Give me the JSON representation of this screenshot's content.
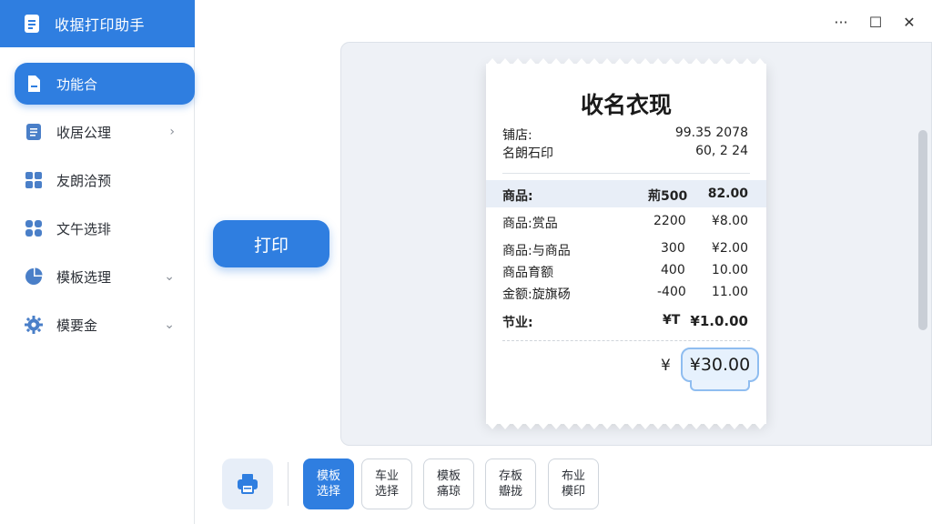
{
  "app": {
    "title": "收据打印助手"
  },
  "sidebar": {
    "items": [
      {
        "label": "功能合",
        "icon": "document-icon",
        "active": true
      },
      {
        "label": "收居公理",
        "icon": "list-icon",
        "caret": "›"
      },
      {
        "label": "友朗洽预",
        "icon": "grid-icon"
      },
      {
        "label": "文午选琲",
        "icon": "apps-icon"
      },
      {
        "label": "模板选理",
        "icon": "pie-chart-icon",
        "caret": "⌄"
      },
      {
        "label": "模要金",
        "icon": "gear-icon",
        "caret": "⌄"
      }
    ]
  },
  "window": {
    "more": "···",
    "maximize": "☐",
    "close": "✕"
  },
  "print_button": {
    "label": "打印"
  },
  "receipt": {
    "title": "收名衣现",
    "meta": [
      {
        "label": "铺店:",
        "value": "99.35 2078"
      },
      {
        "label": "名朗石印",
        "value": "60, 2 24"
      }
    ],
    "header": {
      "name": "商品:",
      "qty": "荊500",
      "amount": "82.00"
    },
    "rows": [
      {
        "name": "商品:赏品",
        "qty": "2200",
        "amount": "¥8.00"
      },
      {
        "name": "商品:与商品",
        "qty": "300",
        "amount": "¥2.00"
      },
      {
        "name": "商品育额",
        "qty": "400",
        "amount": "10.00"
      },
      {
        "name": "金额:旋旗砀",
        "qty": "-400",
        "amount": "11.00"
      }
    ],
    "subtotal": {
      "name": "节业:",
      "qty": "¥T",
      "amount": "¥1.0.00"
    },
    "total": {
      "currency": "¥",
      "amount": "¥30.00"
    }
  },
  "toolbar": {
    "buttons": [
      {
        "label": "模板\n选择",
        "active": true
      },
      {
        "label": "车业\n选择",
        "active": false
      },
      {
        "label": "模板\n痛琼",
        "active": false
      },
      {
        "label": "存板\n瓣拢",
        "active": false
      },
      {
        "label": "布业\n模印",
        "active": false
      }
    ]
  },
  "colors": {
    "accent": "#2f7ee0",
    "highlight": "#e8eef7",
    "preview_bg": "#eef1f6"
  }
}
